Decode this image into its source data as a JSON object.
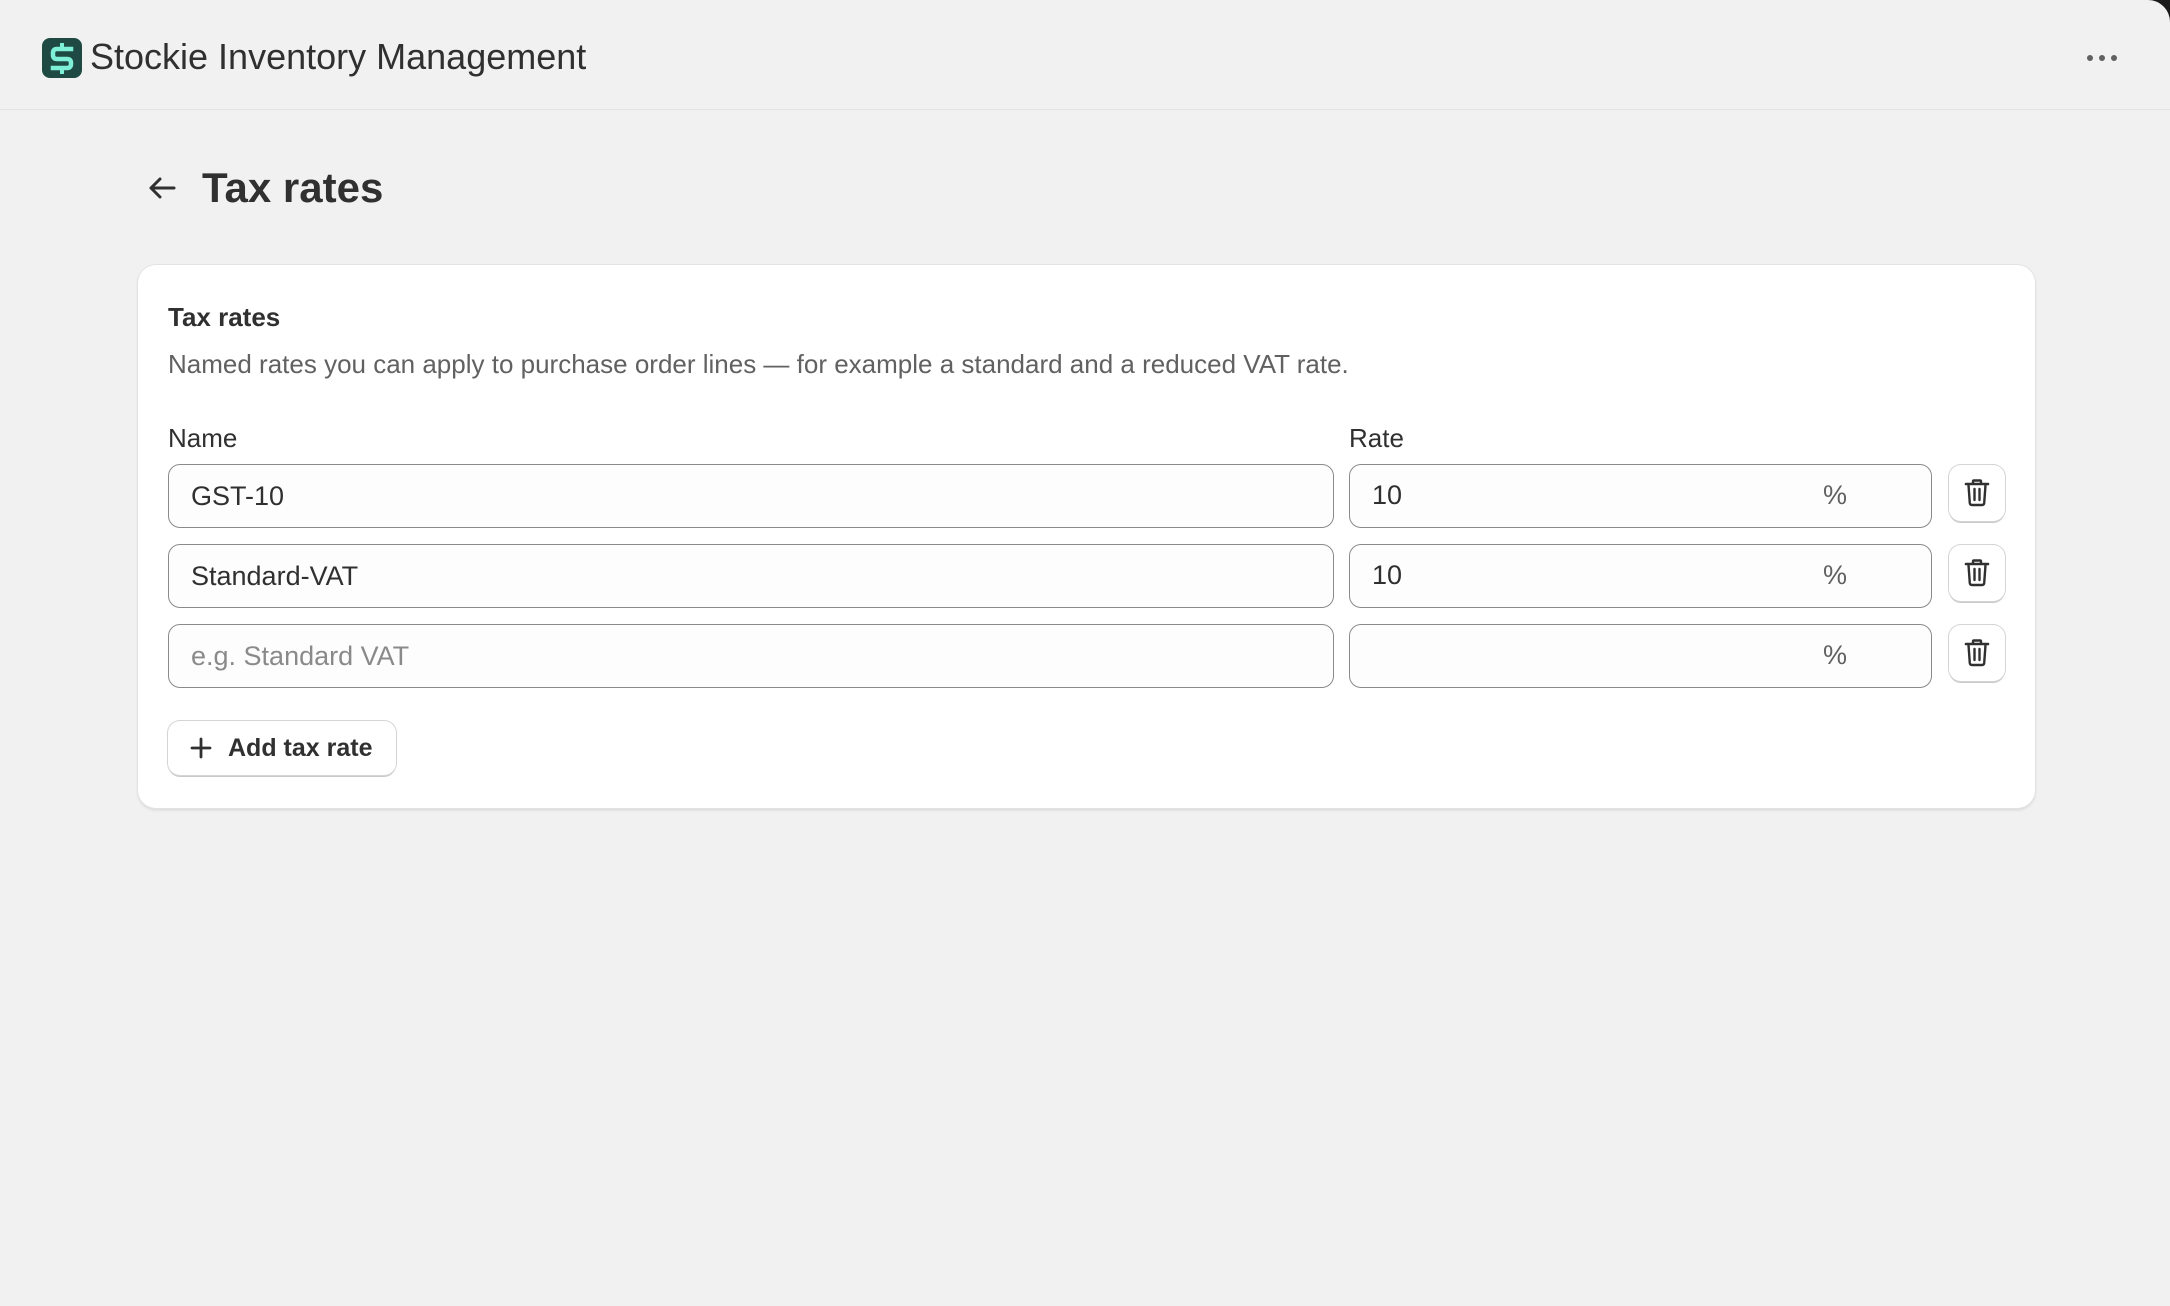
{
  "app": {
    "title": "Stockie Inventory Management",
    "logo_icon": "stockie-logo-icon",
    "brand_color": "#1f4a44",
    "logo_accent": "#7ff0d8"
  },
  "header": {
    "more_icon": "ellipsis-icon"
  },
  "page": {
    "title": "Tax rates",
    "back_icon": "arrow-left-icon"
  },
  "card": {
    "title": "Tax rates",
    "description": "Named rates you can apply to purchase order lines — for example a standard and a reduced VAT rate.",
    "columns": {
      "name": "Name",
      "rate": "Rate"
    },
    "rows": [
      {
        "name": "GST-10",
        "name_placeholder": "e.g. Standard VAT",
        "rate": "10",
        "suffix": "%"
      },
      {
        "name": "Standard-VAT",
        "name_placeholder": "e.g. Standard VAT",
        "rate": "10",
        "suffix": "%"
      },
      {
        "name": "",
        "name_placeholder": "e.g. Standard VAT",
        "rate": "",
        "suffix": "%"
      }
    ],
    "delete_icon": "trash-icon",
    "add_button": {
      "label": "Add tax rate",
      "icon": "plus-icon"
    }
  }
}
